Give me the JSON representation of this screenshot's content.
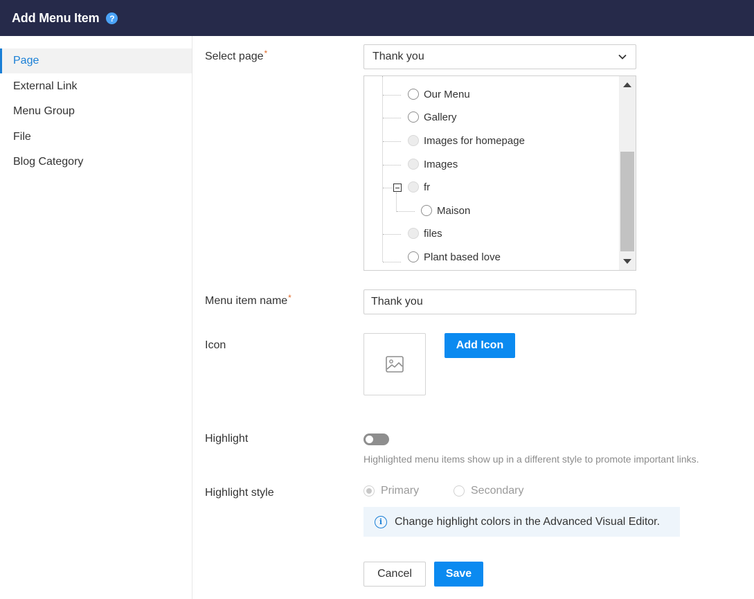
{
  "header": {
    "title": "Add Menu Item",
    "help_icon": "?"
  },
  "sidebar": {
    "items": [
      {
        "label": "Page",
        "active": true
      },
      {
        "label": "External Link",
        "active": false
      },
      {
        "label": "Menu Group",
        "active": false
      },
      {
        "label": "File",
        "active": false
      },
      {
        "label": "Blog Category",
        "active": false
      }
    ]
  },
  "form": {
    "select_page": {
      "label": "Select page",
      "required_mark": "*",
      "value": "Thank you"
    },
    "tree": {
      "nodes": [
        {
          "label": "Our Menu",
          "selectable": true
        },
        {
          "label": "Gallery",
          "selectable": true
        },
        {
          "label": "Images for homepage",
          "selectable": false
        },
        {
          "label": "Images",
          "selectable": false
        },
        {
          "label": "fr",
          "selectable": false,
          "expanded": true
        },
        {
          "label": "Maison",
          "selectable": true
        },
        {
          "label": "files",
          "selectable": false
        },
        {
          "label": "Plant based love",
          "selectable": true
        }
      ]
    },
    "menu_item_name": {
      "label": "Menu item name",
      "required_mark": "*",
      "value": "Thank you"
    },
    "icon": {
      "label": "Icon",
      "add_button": "Add Icon",
      "placeholder_icon": "image-icon"
    },
    "highlight": {
      "label": "Highlight",
      "enabled": false,
      "help_text": "Highlighted menu items show up in a different style to promote important links."
    },
    "highlight_style": {
      "label": "Highlight style",
      "options": [
        {
          "label": "Primary",
          "selected": true
        },
        {
          "label": "Secondary",
          "selected": false
        }
      ],
      "info_icon": "i",
      "info_text": "Change highlight colors in the Advanced Visual Editor."
    },
    "actions": {
      "cancel": "Cancel",
      "save": "Save"
    }
  },
  "colors": {
    "header_bg": "#262a4a",
    "accent": "#0b8af0",
    "required": "#e06a2a",
    "info_bg": "#eef5fb"
  }
}
